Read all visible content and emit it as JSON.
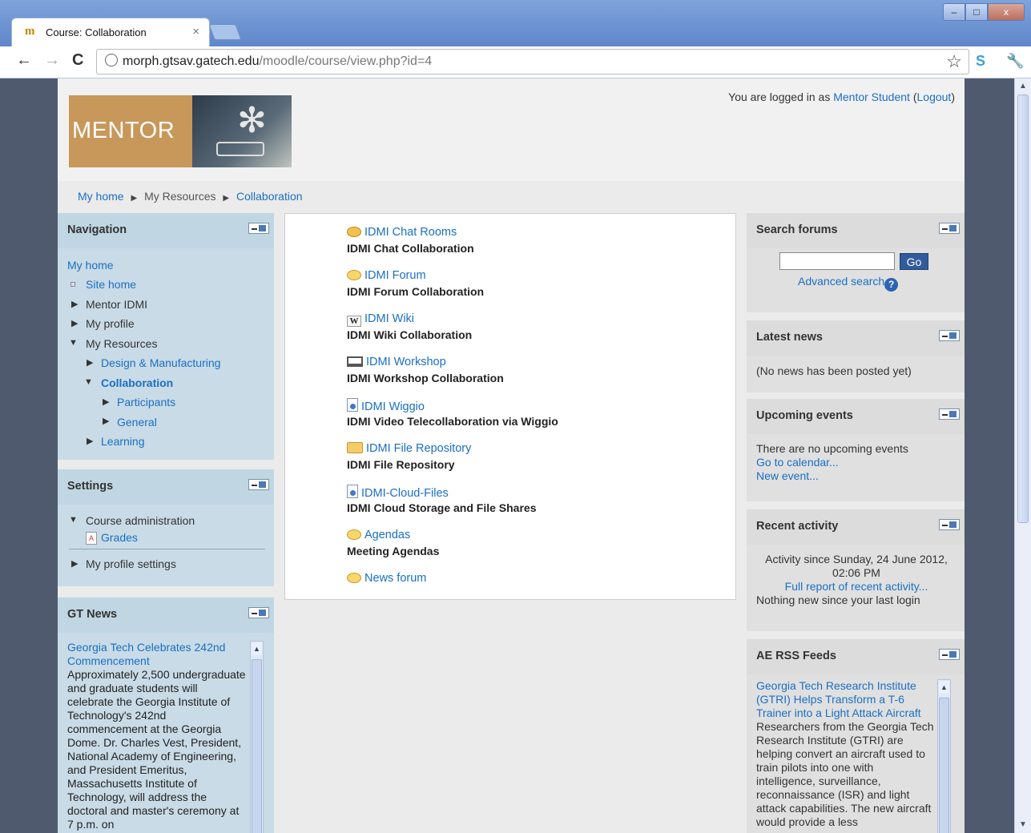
{
  "browser": {
    "tab_title": "Course: Collaboration",
    "tab_close": "×",
    "url_host": "morph.gtsav.gatech.edu",
    "url_path": "/moodle/course/view.php?id=4",
    "window_buttons": {
      "minimize": "–",
      "maximize": "□",
      "close": "x"
    },
    "icons": [
      "back-icon",
      "forward-icon",
      "reload-icon",
      "star-icon",
      "extension-icon",
      "wrench-icon"
    ]
  },
  "header": {
    "logo_text": "MENTOR",
    "login_prefix": "You are logged in as ",
    "login_user": "Mentor Student",
    "login_open": " (",
    "logout": "Logout",
    "login_close": ")"
  },
  "breadcrumb": [
    "My home",
    "My Resources",
    "Collaboration"
  ],
  "navigation": {
    "title": "Navigation",
    "items": {
      "my_home": "My home",
      "site_home": "Site home",
      "mentor_idmi": "Mentor IDMI",
      "my_profile": "My profile",
      "my_resources": "My Resources",
      "design": "Design & Manufacturing",
      "collaboration": "Collaboration",
      "participants": "Participants",
      "general": "General",
      "learning": "Learning"
    }
  },
  "settings": {
    "title": "Settings",
    "course_admin": "Course administration",
    "grades": "Grades",
    "profile_settings": "My profile settings"
  },
  "gt_news": {
    "title": "GT News",
    "headline": "Georgia Tech Celebrates 242nd Commencement",
    "body": "Approximately 2,500 undergraduate and graduate students will celebrate the Georgia Institute of Technology's 242nd commencement at the Georgia Dome. Dr. Charles Vest, President, National Academy of Engineering, and President Emeritus, Massachusetts Institute of Technology, will address the doctoral and master's ceremony at 7 p.m. on"
  },
  "activities": [
    {
      "icon": "chat-icon",
      "name": "IDMI Chat Rooms",
      "desc": "IDMI Chat Collaboration"
    },
    {
      "icon": "forum-icon",
      "name": "IDMI Forum",
      "desc": "IDMI Forum Collaboration"
    },
    {
      "icon": "wiki-icon",
      "name": "IDMI Wiki",
      "desc": "IDMI Wiki Collaboration"
    },
    {
      "icon": "workshop-icon",
      "name": "IDMI Workshop",
      "desc": "IDMI Workshop Collaboration"
    },
    {
      "icon": "page-icon",
      "name": "IDMI Wiggio",
      "desc": "IDMI Video Telecollaboration via Wiggio"
    },
    {
      "icon": "folder-icon",
      "name": "IDMI File Repository",
      "desc": "IDMI File Repository"
    },
    {
      "icon": "page-icon",
      "name": "IDMI-Cloud-Files",
      "desc": "IDMI Cloud Storage and File Shares"
    },
    {
      "icon": "forum-icon",
      "name": "Agendas",
      "desc": "Meeting Agendas"
    },
    {
      "icon": "forum-icon",
      "name": "News forum",
      "desc": ""
    }
  ],
  "search_forums": {
    "title": "Search forums",
    "go": "Go",
    "advanced": "Advanced search",
    "help": "?"
  },
  "latest_news": {
    "title": "Latest news",
    "text": "(No news has been posted yet)"
  },
  "upcoming": {
    "title": "Upcoming events",
    "text": "There are no upcoming events",
    "calendar": "Go to calendar...",
    "new_event": "New event..."
  },
  "recent": {
    "title": "Recent activity",
    "since": "Activity since Sunday, 24 June 2012, 02:06 PM",
    "full_report": "Full report of recent activity...",
    "nothing": "Nothing new since your last login"
  },
  "rss": {
    "title": "AE RSS Feeds",
    "headline": "Georgia Tech Research Institute (GTRI) Helps Transform a T-6 Trainer into a Light Attack Aircraft",
    "body": "Researchers from the Georgia Tech Research Institute (GTRI) are helping convert an aircraft used to train pilots into one with intelligence, surveillance, reconnaissance (ISR) and light attack capabilities. The new aircraft would provide a less"
  }
}
